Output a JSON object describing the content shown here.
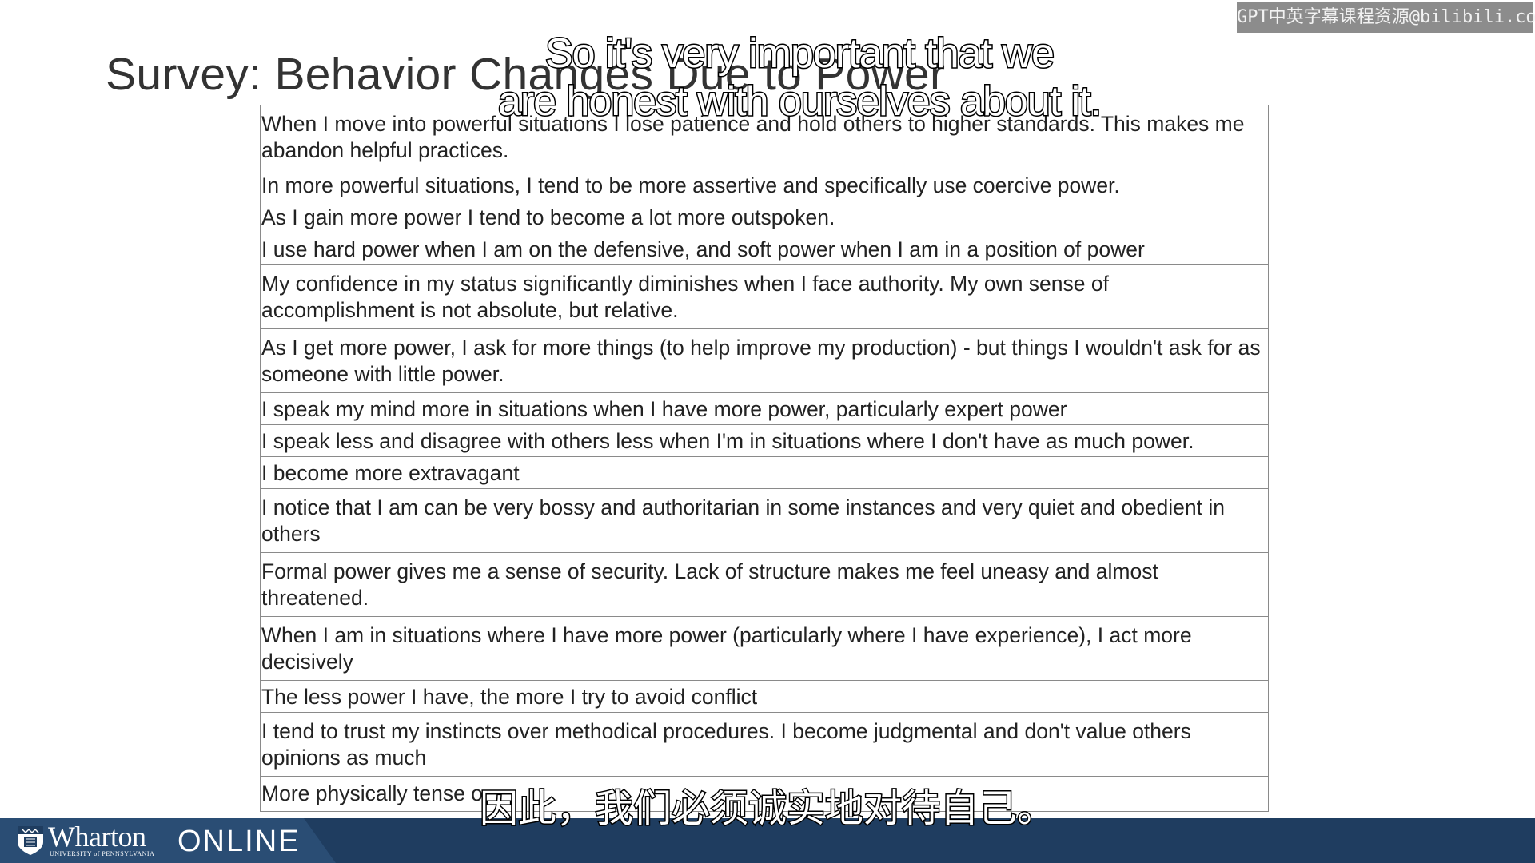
{
  "slide": {
    "title": "Survey: Behavior Changes Due to Power",
    "rows": [
      "When I move into powerful situations I lose patience and hold others to higher standards. This makes me abandon helpful practices.",
      "In more powerful situations, I tend to be more assertive and specifically use coercive power.",
      "As I gain more power I tend to become a lot more outspoken.",
      "I use hard power when I am on the defensive, and soft power when I am in a position of power",
      "My confidence in my status significantly diminishes when I face authority. My own sense of accomplishment is not absolute, but relative.",
      "As I get more power, I ask for more things (to help improve my production) - but things I wouldn't ask for as someone with little power.",
      "I speak my mind more in situations when I have more power, particularly expert power",
      "I speak less and disagree with others less when I'm in situations where I don't have as much power.",
      "I become more extravagant",
      "I notice that I am can be very bossy and authoritarian in some instances and very quiet and obedient in others",
      "Formal power gives me a sense of security. Lack of structure makes me feel uneasy and almost threatened.",
      "When I am in situations where I have more power (particularly where I have experience), I act more decisively",
      "The less power I have, the more I try to avoid conflict",
      "I tend to trust my instincts over methodical procedures. I become judgmental and don't value others opinions as much",
      "More physically tense o"
    ]
  },
  "subtitles": {
    "english_line1": "So it's very important that we",
    "english_line2": "are honest with ourselves about it.",
    "chinese": "因此，我们必须诚实地对待自己。"
  },
  "watermark": "GPT中英字幕课程资源@bilibili.com",
  "footer": {
    "brand": "Wharton",
    "brand_sub": "UNIVERSITY of PENNSYLVANIA",
    "product": "ONLINE",
    "bar_color": "#1f3d60"
  }
}
